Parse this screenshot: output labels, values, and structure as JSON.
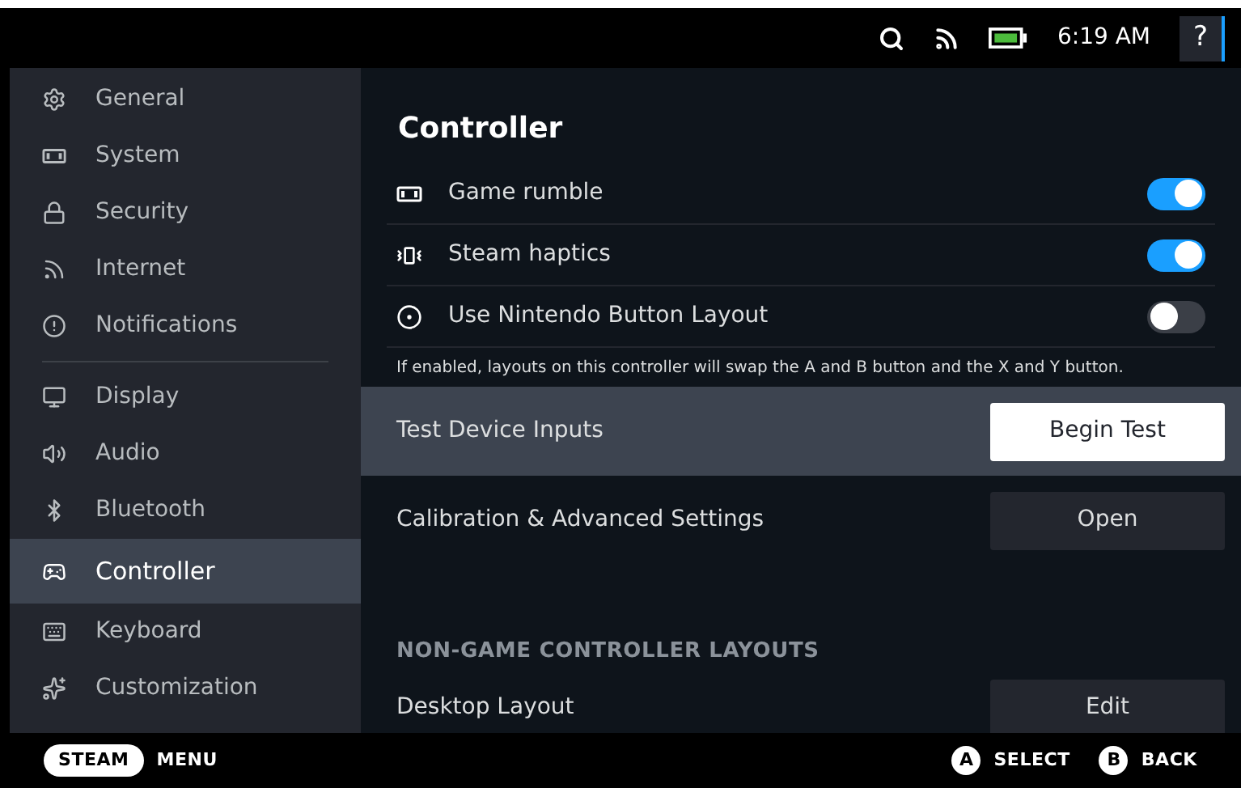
{
  "top_bar": {
    "time": "6:19 AM",
    "help": "?"
  },
  "sidebar": {
    "groups": [
      [
        {
          "label": "General",
          "selected": false
        },
        {
          "label": "System",
          "selected": false
        },
        {
          "label": "Security",
          "selected": false
        },
        {
          "label": "Internet",
          "selected": false
        },
        {
          "label": "Notifications",
          "selected": false
        }
      ],
      [
        {
          "label": "Display",
          "selected": false
        },
        {
          "label": "Audio",
          "selected": false
        },
        {
          "label": "Bluetooth",
          "selected": false
        },
        {
          "label": "Controller",
          "selected": true
        },
        {
          "label": "Keyboard",
          "selected": false
        },
        {
          "label": "Customization",
          "selected": false
        }
      ]
    ]
  },
  "main": {
    "title": "Controller",
    "toggles": [
      {
        "label": "Game rumble",
        "on": true
      },
      {
        "label": "Steam haptics",
        "on": true
      },
      {
        "label": "Use Nintendo Button Layout",
        "on": false
      }
    ],
    "note": "If enabled, layouts on this controller will swap the A and B button and the X and Y button.",
    "actions": [
      {
        "label": "Test Device Inputs",
        "button": "Begin Test",
        "selected": true
      },
      {
        "label": "Calibration & Advanced Settings",
        "button": "Open",
        "selected": false
      }
    ],
    "section": "NON-GAME CONTROLLER LAYOUTS",
    "layouts": [
      {
        "label": "Desktop Layout",
        "button": "Edit",
        "selected": false
      }
    ]
  },
  "bottom_bar": {
    "steam": "STEAM",
    "menu": "MENU",
    "hints": [
      {
        "key": "A",
        "label": "SELECT"
      },
      {
        "key": "B",
        "label": "BACK"
      }
    ]
  }
}
